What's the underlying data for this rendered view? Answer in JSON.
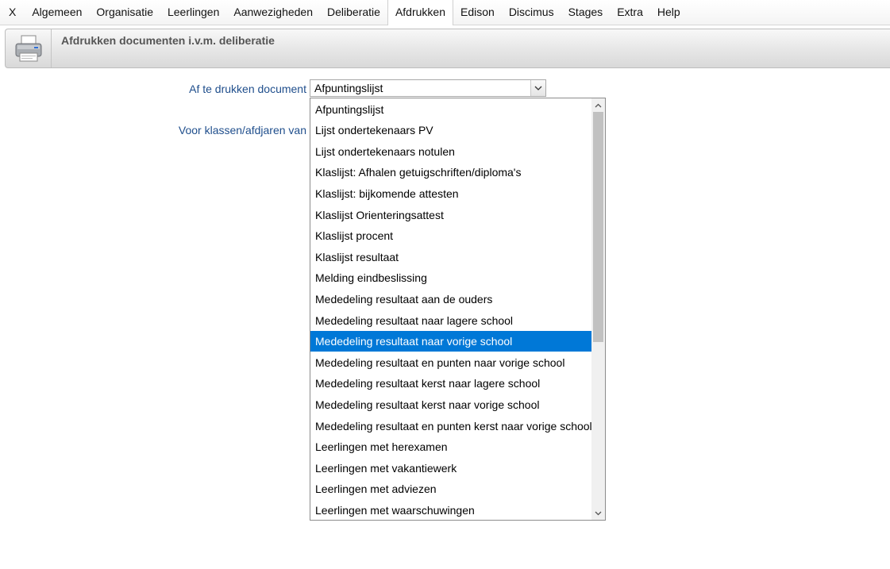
{
  "menu": {
    "items": [
      "X",
      "Algemeen",
      "Organisatie",
      "Leerlingen",
      "Aanwezigheden",
      "Deliberatie",
      "Afdrukken",
      "Edison",
      "Discimus",
      "Stages",
      "Extra",
      "Help"
    ],
    "active": "Afdrukken"
  },
  "header": {
    "title": "Afdrukken documenten i.v.m. deliberatie",
    "icon": "printer-icon"
  },
  "form": {
    "document_label": "Af te drukken document",
    "document_value": "Afpuntingslijst",
    "classes_label": "Voor klassen/afdjaren van"
  },
  "dropdown": {
    "selected_index": 11,
    "options": [
      "Afpuntingslijst",
      "Lijst ondertekenaars PV",
      "Lijst ondertekenaars notulen",
      "Klaslijst: Afhalen getuigschriften/diploma's",
      "Klaslijst: bijkomende attesten",
      "Klaslijst Orienteringsattest",
      "Klaslijst procent",
      "Klaslijst resultaat",
      "Melding eindbeslissing",
      "Mededeling resultaat aan de ouders",
      "Mededeling resultaat naar lagere school",
      "Mededeling resultaat naar vorige school",
      "Mededeling resultaat en punten naar vorige school",
      "Mededeling resultaat kerst naar lagere school",
      "Mededeling resultaat kerst naar vorige school",
      "Mededeling resultaat en punten kerst naar vorige school",
      "Leerlingen met herexamen",
      "Leerlingen met vakantiewerk",
      "Leerlingen met adviezen",
      "Leerlingen met waarschuwingen"
    ]
  },
  "colors": {
    "label": "#1f4e8c",
    "selection": "#0078d7"
  }
}
